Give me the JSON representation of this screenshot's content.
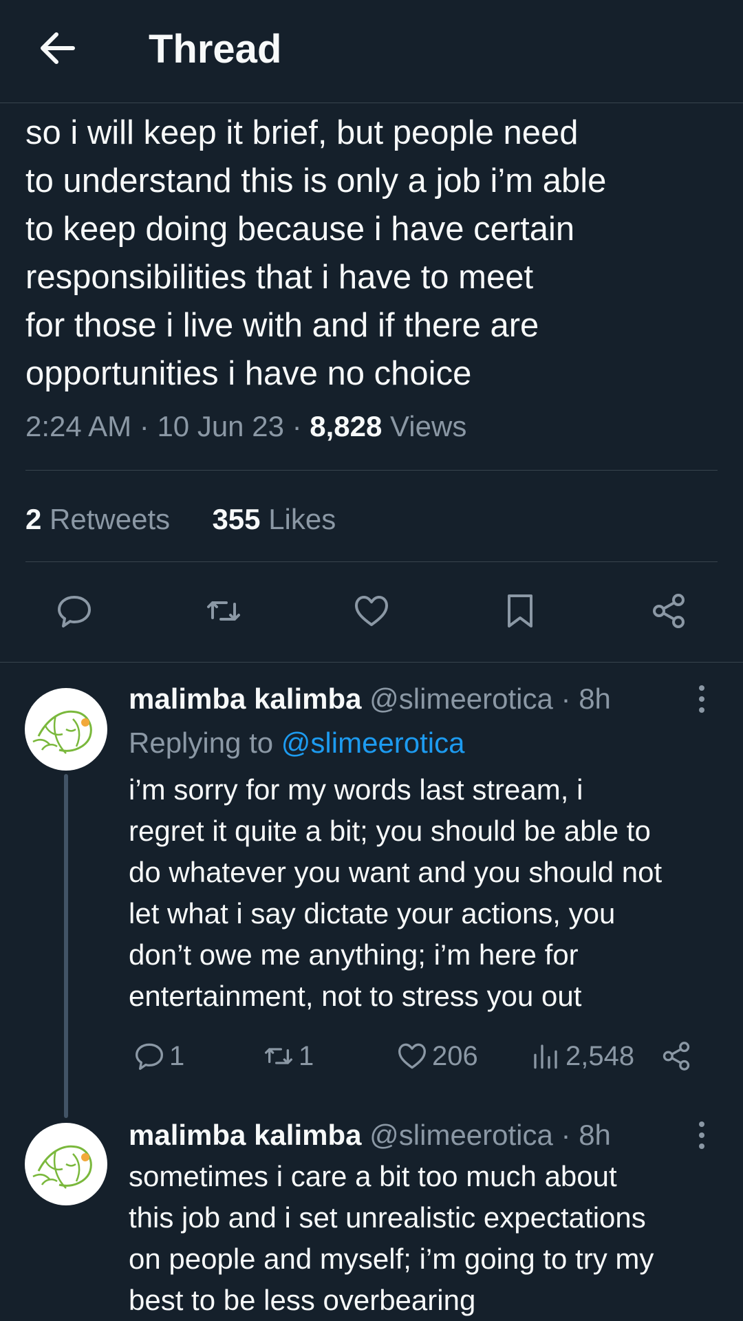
{
  "header": {
    "title": "Thread"
  },
  "tweet": {
    "text": "so i will keep it brief, but people need\nto understand this is only a job i’m able\nto keep doing because i have certain\nresponsibilities that i have to meet\nfor those i live with and if there are\nopportunities i have no choice",
    "time": "2:24 AM",
    "date": "10 Jun 23",
    "views_count": "8,828",
    "views_label": "Views",
    "retweets_count": "2",
    "retweets_label": "Retweets",
    "likes_count": "355",
    "likes_label": "Likes"
  },
  "replies": [
    {
      "name": "malimba kalimba",
      "handle": "@slimeerotica",
      "time": "8h",
      "replying_prefix": "Replying to",
      "replying_to": "@slimeerotica",
      "text": "i’m sorry for my words last stream, i\nregret it quite a bit; you should be able to\ndo whatever you want and you should not\nlet what i say dictate your actions, you\ndon’t owe me anything; i’m here for\nentertainment, not to stress you out",
      "reply_count": "1",
      "retweet_count": "1",
      "like_count": "206",
      "view_count": "2,548"
    },
    {
      "name": "malimba kalimba",
      "handle": "@slimeerotica",
      "time": "8h",
      "text": "sometimes i care a bit too much about\nthis job and i set unrealistic expectations\non people and myself; i’m going to try my\nbest to be less overbearing"
    }
  ],
  "colors": {
    "background": "#15202b",
    "text": "#f7f9f9",
    "muted": "#8b98a5",
    "link": "#1d9bf0",
    "divider": "#38444d"
  }
}
